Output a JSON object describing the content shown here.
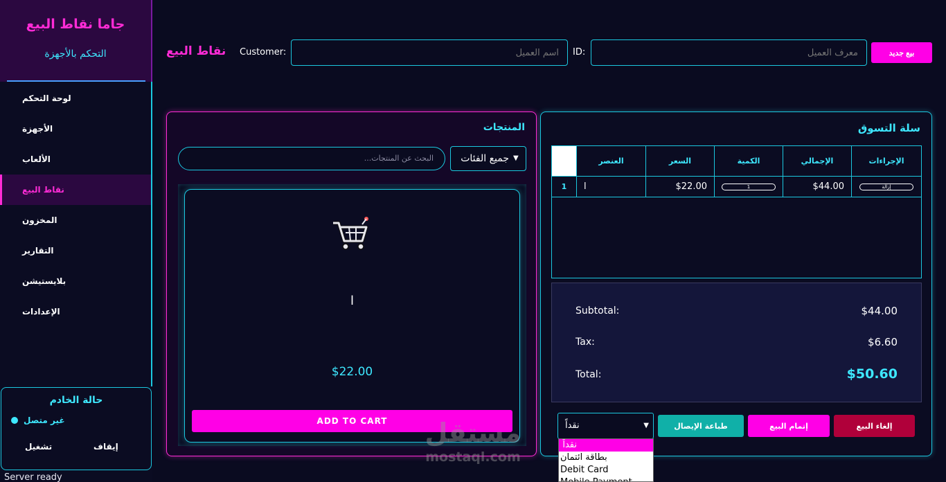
{
  "sidebar": {
    "title": "جاما نقاط البيع",
    "subtitle": "التحكم بالأجهزة",
    "items": [
      {
        "label": "لوحة التحكم"
      },
      {
        "label": "الأجهزة"
      },
      {
        "label": "الألعاب"
      },
      {
        "label": "نقاط البيع"
      },
      {
        "label": "المخزون"
      },
      {
        "label": "التقارير"
      },
      {
        "label": "بلايستيشن"
      },
      {
        "label": "الإعدادات"
      }
    ],
    "active_index": 3
  },
  "server": {
    "title": "حالة الخادم",
    "status": "غير متصل",
    "stop_label": "إيقاف",
    "start_label": "تشغيل",
    "ready_text": "Server ready"
  },
  "topbar": {
    "title": "نقاط البيع",
    "customer_label": "Customer:",
    "customer_placeholder": "اسم العميل",
    "id_label": "ID:",
    "id_placeholder": "معرف العميل",
    "new_sale_label": "بيع جديد"
  },
  "products": {
    "title": "المنتجات",
    "search_placeholder": "البحث عن المنتجات...",
    "category_value": "جميع الفئات",
    "items": [
      {
        "icon": "shopping-cart-icon",
        "name": "ا",
        "price": "$22.00",
        "button": "ADD TO CART"
      }
    ]
  },
  "cart": {
    "title": "سلة التسوق",
    "columns": [
      "الإجراءات",
      "الإجمالي",
      "الكمية",
      "السعر",
      "العنصر"
    ],
    "rows": [
      {
        "index": "1",
        "item": "ا",
        "price": "$22.00",
        "quantity_label": "1",
        "total": "$44.00",
        "action_label": "إزالة"
      }
    ],
    "subtotal_label": "Subtotal:",
    "subtotal_value": "$44.00",
    "tax_label": "Tax:",
    "tax_value": "$6.60",
    "total_label": "Total:",
    "total_value": "$50.60",
    "payment_value": "نقداً",
    "payment_options": [
      "نقداً",
      "بطاقة ائتمان",
      "Debit Card",
      "Mobile Payment"
    ],
    "print_label": "طباعة الإيصال",
    "complete_label": "إتمام البيع",
    "cancel_label": "إلغاء البيع"
  },
  "watermark": {
    "arabic": "مستقل",
    "latin": "mostaql.com"
  },
  "colors": {
    "accent_magenta": "#ff00e6",
    "accent_cyan": "#3ee8ff",
    "background": "#0a0b20",
    "complete_button": "#ff00e6",
    "print_button": "#10b0a8",
    "cancel_button": "#b0003a"
  }
}
